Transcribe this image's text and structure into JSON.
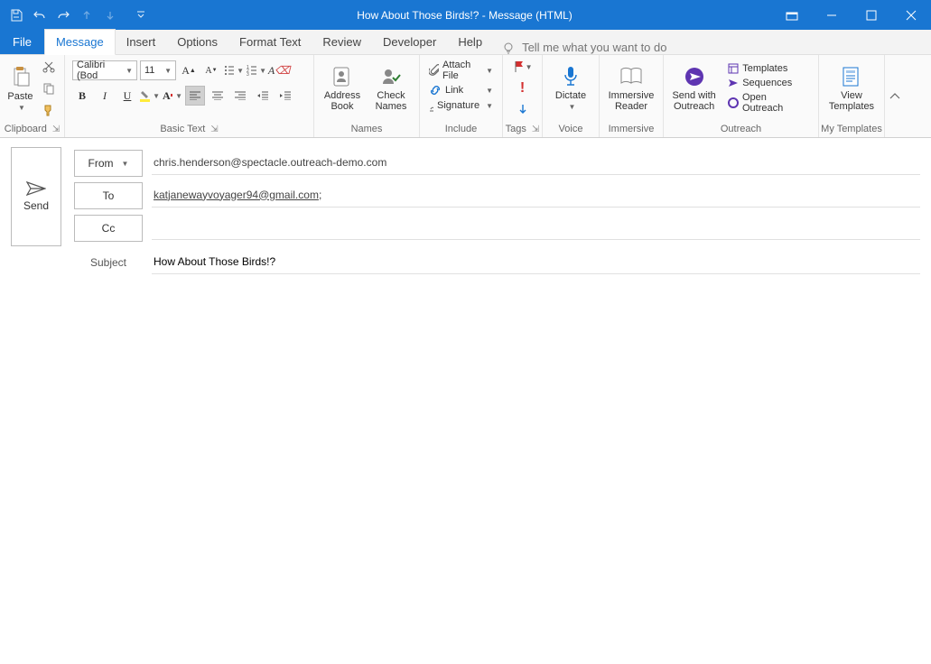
{
  "titlebar": {
    "title": "How About Those Birds!?  -  Message (HTML)"
  },
  "tabs": {
    "file": "File",
    "message": "Message",
    "insert": "Insert",
    "options": "Options",
    "format_text": "Format Text",
    "review": "Review",
    "developer": "Developer",
    "help": "Help",
    "tell_me": "Tell me what you want to do"
  },
  "ribbon": {
    "clipboard": {
      "paste": "Paste",
      "label": "Clipboard"
    },
    "basic_text": {
      "font": "Calibri (Bod",
      "size": "11",
      "label": "Basic Text"
    },
    "names": {
      "address_book": "Address\nBook",
      "check_names": "Check\nNames",
      "label": "Names"
    },
    "include": {
      "attach_file": "Attach File",
      "link": "Link",
      "signature": "Signature",
      "label": "Include"
    },
    "tags": {
      "label": "Tags"
    },
    "voice": {
      "dictate": "Dictate",
      "label": "Voice"
    },
    "immersive": {
      "immersive_reader": "Immersive\nReader",
      "label": "Immersive"
    },
    "outreach": {
      "send_with": "Send with\nOutreach",
      "send_with_icon_dot": "●",
      "templates": "Templates",
      "sequences": "Sequences",
      "open_outreach": "Open Outreach",
      "label": "Outreach"
    },
    "my_templates": {
      "view": "View\nTemplates",
      "label": "My Templates"
    }
  },
  "compose": {
    "send": "Send",
    "from_label": "From",
    "from_value": "chris.henderson@spectacle.outreach-demo.com",
    "to_label": "To",
    "to_value": "katjanewayvoyager94@gmail.com",
    "to_suffix": ";",
    "cc_label": "Cc",
    "cc_value": "",
    "subject_label": "Subject",
    "subject_value": "How About Those Birds!?",
    "body": ""
  }
}
